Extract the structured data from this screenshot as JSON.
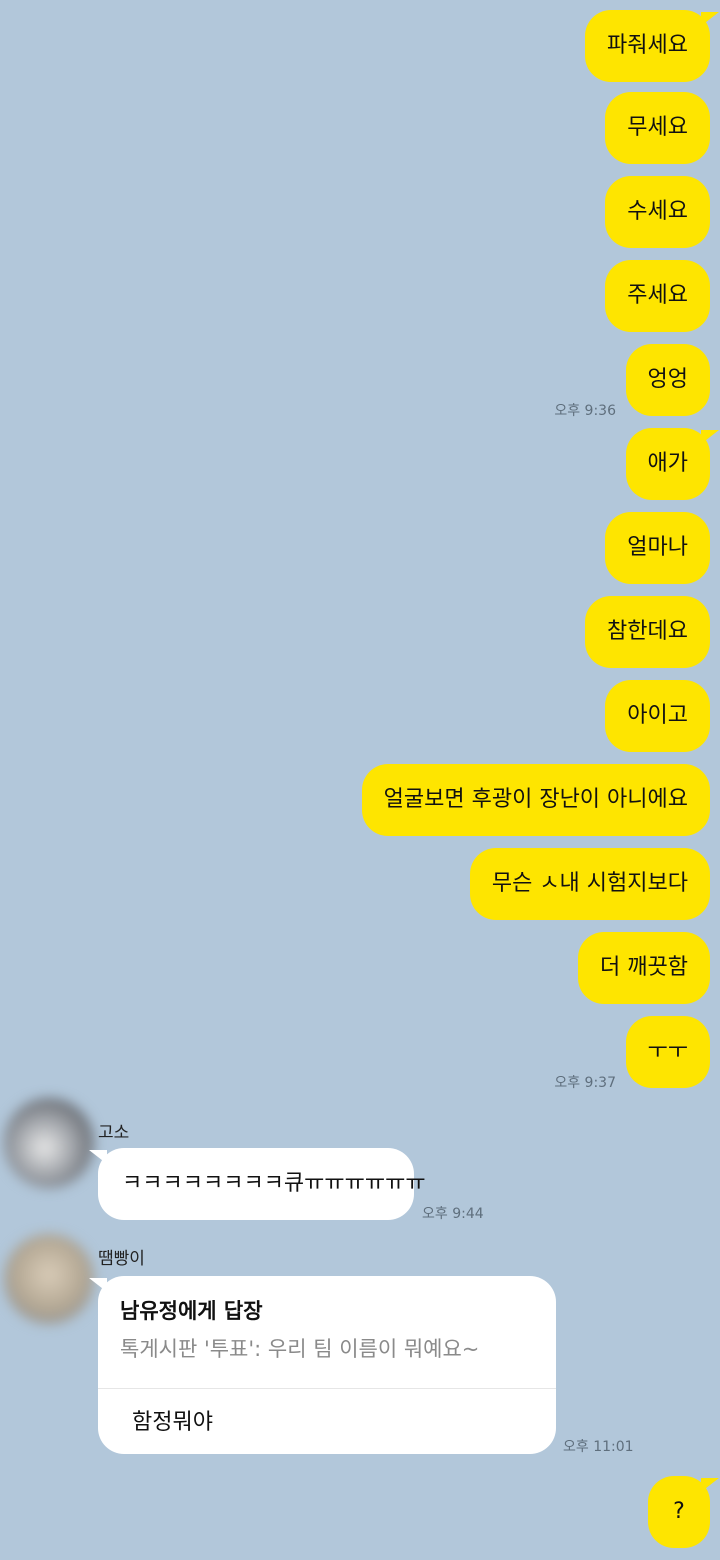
{
  "my_messages": [
    "파줘세요",
    "무세요",
    "수세요",
    "주세요",
    "엉엉",
    "애가",
    "얼마나",
    "참한데요",
    "아이고",
    "얼굴보면 후광이 장난이 아니에요",
    "무슨 ㅅ내 시험지보다",
    "더 깨끗함",
    "ㅜㅜ",
    "?"
  ],
  "times": {
    "t1": "오후 9:36",
    "t2": "오후 9:37",
    "t3": "오후 9:44",
    "t4": "오후 11:01"
  },
  "gosso": {
    "name": "고소",
    "message": "ㅋㅋㅋㅋㅋㅋㅋㅋ큐ㅠㅠㅠㅠㅠㅠ"
  },
  "ttaem": {
    "name": "땜빵이",
    "reply_to": "남유정에게 답장",
    "quoted": "톡게시판 '투표': 우리 팀 이름이 뭐예요~",
    "message": "함정뭐야"
  }
}
